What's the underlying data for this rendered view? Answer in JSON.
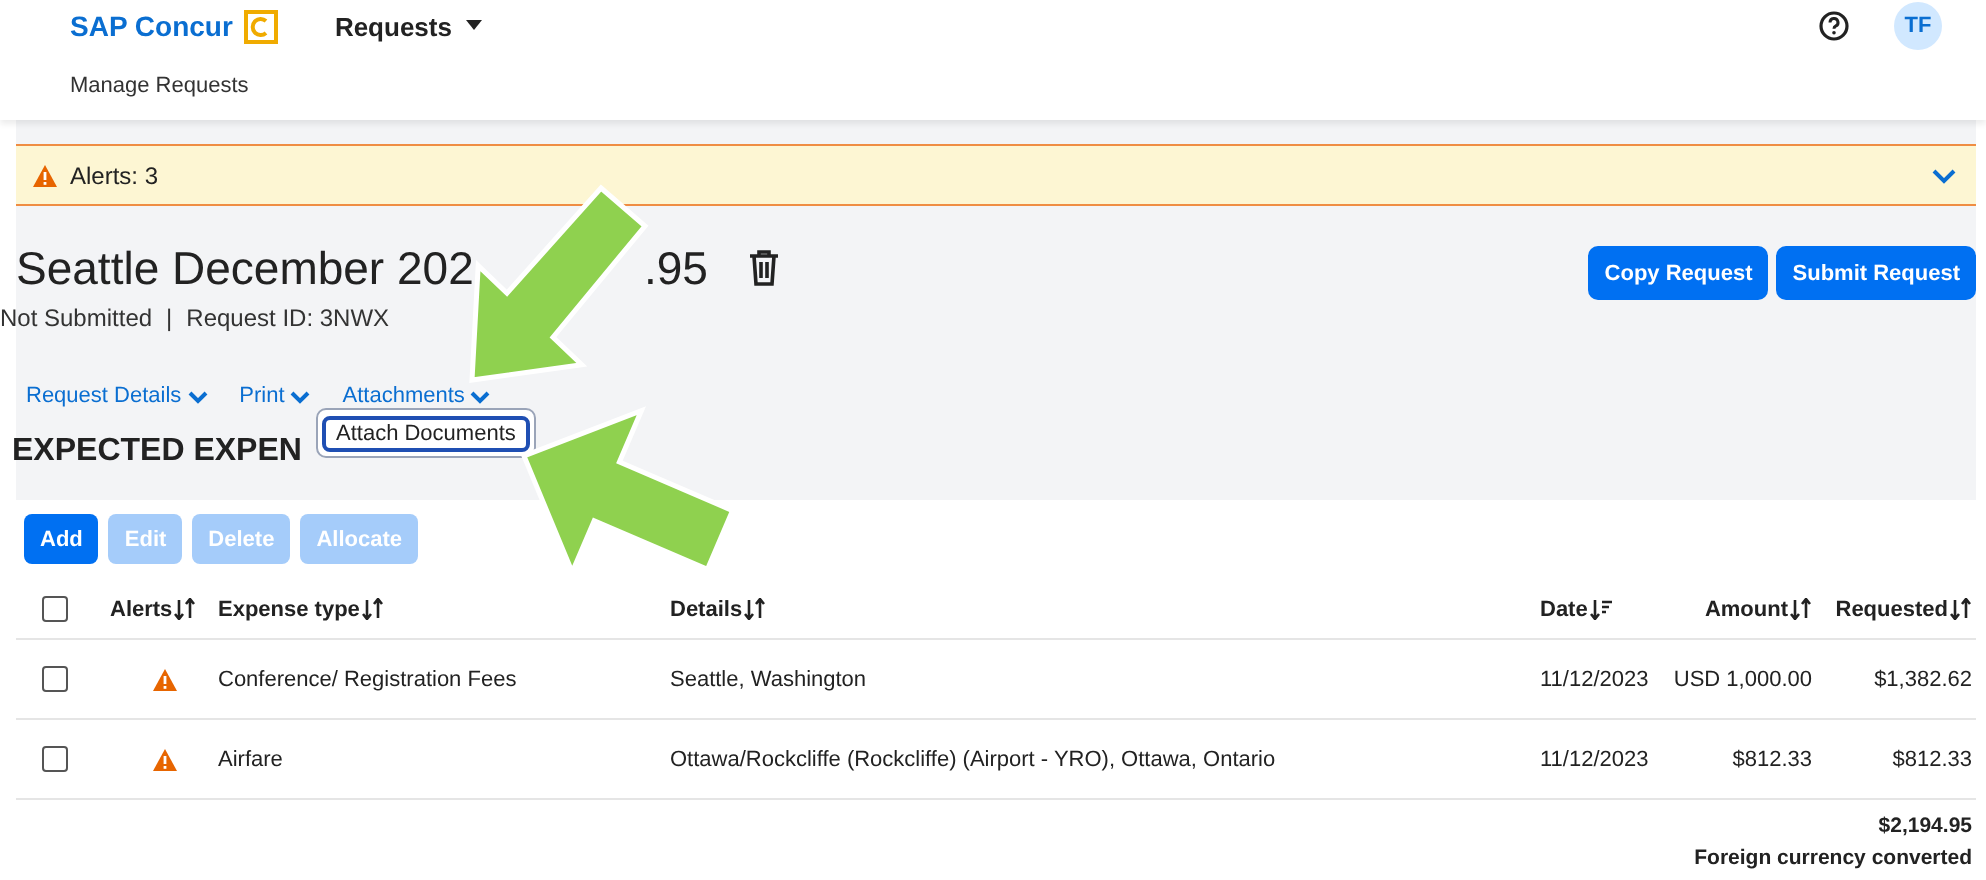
{
  "header": {
    "brand": "SAP Concur",
    "app_menu": "Requests",
    "avatar": "TF"
  },
  "subnav": [
    "Manage Requests"
  ],
  "alerts": {
    "label": "Alerts: 3",
    "expanded": false
  },
  "request": {
    "title_start": "Seattle December 202",
    "title_end": ".95",
    "status": "Not Submitted",
    "separator": "|",
    "request_id": "Request ID: 3NWX"
  },
  "actions": [
    {
      "label": "Copy Request"
    },
    {
      "label": "Submit Request"
    }
  ],
  "menus": [
    {
      "label": "Request Details",
      "open": false
    },
    {
      "label": "Print",
      "open": false
    },
    {
      "label": "Attachments",
      "open": true
    }
  ],
  "dropdown": {
    "items": [
      "Attach Documents"
    ]
  },
  "section_title": "EXPECTED EXPEN",
  "toolbar": [
    {
      "label": "Add",
      "disabled": false
    },
    {
      "label": "Edit",
      "disabled": true
    },
    {
      "label": "Delete",
      "disabled": true
    },
    {
      "label": "Allocate",
      "disabled": true
    }
  ],
  "table": {
    "select_all_checked": false,
    "columns": [
      {
        "label": "Alerts",
        "sorted": false
      },
      {
        "label": "Expense type",
        "sorted": false
      },
      {
        "label": "Details",
        "sorted": false
      },
      {
        "label": "Date",
        "sorted": true
      },
      {
        "label": "Amount",
        "sorted": false
      },
      {
        "label": "Requested",
        "sorted": false
      }
    ],
    "rows": [
      {
        "checked": false,
        "alert": true,
        "expense_type": "Conference/ Registration Fees",
        "details": "Seattle, Washington",
        "date": "11/12/2023",
        "amount": "USD 1,000.00",
        "requested": "$1,382.62"
      },
      {
        "checked": false,
        "alert": true,
        "expense_type": "Airfare",
        "details": "Ottawa/Rockcliffe (Rockcliffe) (Airport - YRO), Ottawa, Ontario",
        "date": "11/12/2023",
        "amount": "$812.33",
        "requested": "$812.33"
      }
    ]
  },
  "total": {
    "amount": "$2,194.95",
    "note": "Foreign currency converted"
  }
}
